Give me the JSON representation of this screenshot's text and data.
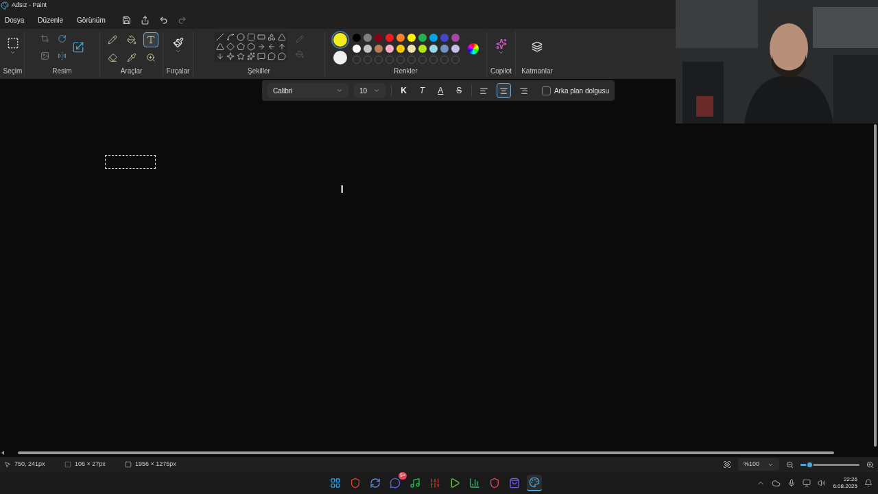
{
  "window": {
    "title": "Adsız - Paint"
  },
  "menu": [
    "Dosya",
    "Düzenle",
    "Görünüm"
  ],
  "ribbon": {
    "groups": [
      "Seçim",
      "Resim",
      "Araçlar",
      "Fırçalar",
      "Şekiller",
      "Renkler",
      "Copilot",
      "Katmanlar"
    ],
    "tools": [
      {
        "kind": "pencil",
        "selected": false
      },
      {
        "kind": "fill",
        "selected": false
      },
      {
        "kind": "text",
        "selected": true
      },
      {
        "kind": "eraser",
        "selected": false
      },
      {
        "kind": "picker",
        "selected": false
      },
      {
        "kind": "magnifier",
        "selected": false
      }
    ],
    "primary_color": {
      "color": "#f2ee1e",
      "selected": true
    },
    "secondary_color": {
      "color": "#f0f0f0",
      "selected": false
    },
    "palette": [
      {
        "color": "#000000"
      },
      {
        "color": "#7f7f7f"
      },
      {
        "color": "#880015"
      },
      {
        "color": "#ed1c24"
      },
      {
        "color": "#ff7f27"
      },
      {
        "color": "#fff200"
      },
      {
        "color": "#22b14c"
      },
      {
        "color": "#00a2e8"
      },
      {
        "color": "#3f48cc"
      },
      {
        "color": "#a349a4"
      },
      {
        "color": "#ffffff"
      },
      {
        "color": "#c3c3c3"
      },
      {
        "color": "#b97a57"
      },
      {
        "color": "#ffaec9"
      },
      {
        "color": "#ffc90e"
      },
      {
        "color": "#efe4b0"
      },
      {
        "color": "#b5e61d"
      },
      {
        "color": "#99d9ea"
      },
      {
        "color": "#7092be"
      },
      {
        "color": "#c8bfe7"
      }
    ]
  },
  "text_toolbar": {
    "font": "Calibri",
    "size": "10",
    "styles": [
      {
        "label": "K",
        "kind": "bold"
      },
      {
        "label": "T",
        "kind": "italic"
      },
      {
        "label": "A",
        "kind": "underline"
      },
      {
        "label": "S",
        "kind": "strike"
      }
    ],
    "align": [
      {
        "kind": "left",
        "selected": false
      },
      {
        "kind": "center",
        "selected": true
      },
      {
        "kind": "right",
        "selected": false
      }
    ],
    "background_fill": {
      "label": "Arka plan dolgusu",
      "checked": false
    }
  },
  "status_bar": {
    "cursor": "750, 241px",
    "selection": "106 × 27px",
    "canvas_size": "1956 × 1275px",
    "zoom": "%100",
    "zoom_slider": {
      "level": 0.15
    }
  },
  "taskbar": {
    "apps": [
      {
        "kind": "start",
        "selected": false
      },
      {
        "kind": "browser",
        "selected": false
      },
      {
        "kind": "sync",
        "selected": false
      },
      {
        "kind": "chat",
        "selected": false,
        "badge": "9+"
      },
      {
        "kind": "music",
        "selected": false
      },
      {
        "kind": "mixer",
        "selected": false
      },
      {
        "kind": "player",
        "selected": false
      },
      {
        "kind": "meter",
        "selected": false
      },
      {
        "kind": "vpn",
        "selected": false
      },
      {
        "kind": "store",
        "selected": false
      },
      {
        "kind": "paint",
        "selected": true
      }
    ],
    "time": "22:26",
    "date": "6.08.2025"
  }
}
